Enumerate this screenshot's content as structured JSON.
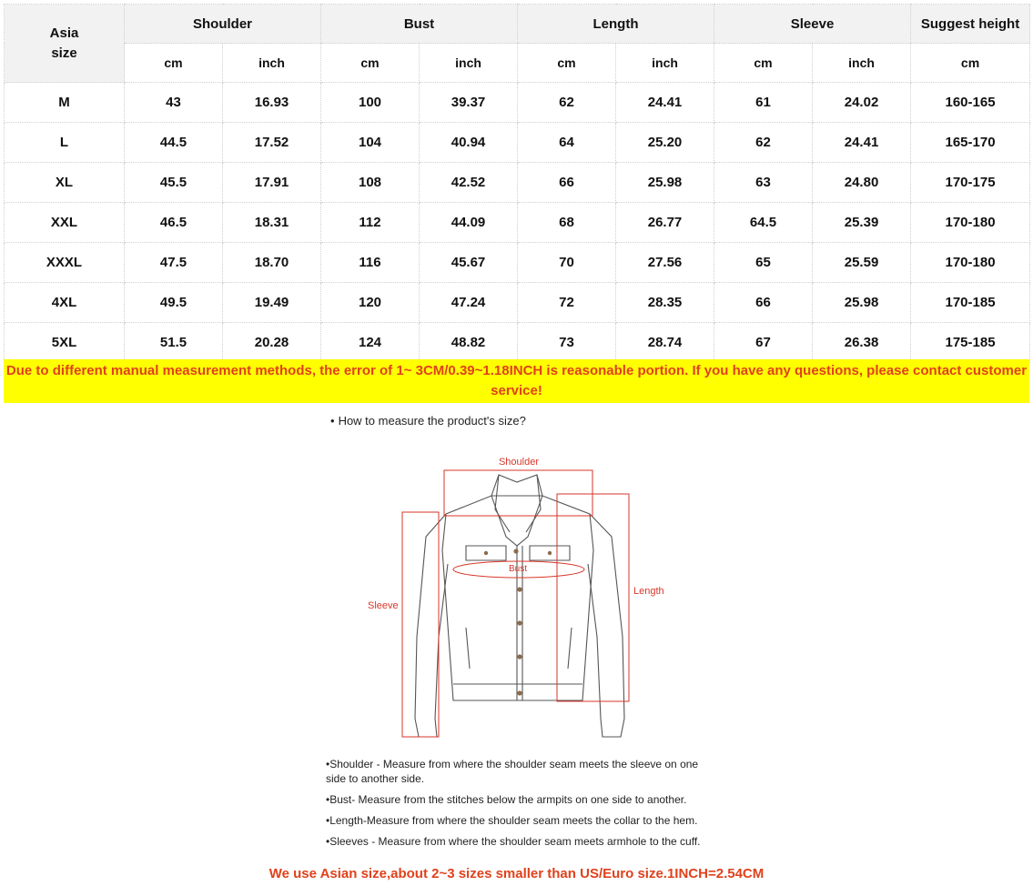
{
  "table": {
    "groups": [
      "Shoulder",
      "Bust",
      "Length",
      "Sleeve",
      "Suggest height"
    ],
    "asia_header_line1": "Asia",
    "asia_header_line2": "size",
    "units": [
      "cm",
      "inch",
      "cm",
      "inch",
      "cm",
      "inch",
      "cm",
      "inch",
      "cm"
    ],
    "rows": [
      [
        "M",
        "43",
        "16.93",
        "100",
        "39.37",
        "62",
        "24.41",
        "61",
        "24.02",
        "160-165"
      ],
      [
        "L",
        "44.5",
        "17.52",
        "104",
        "40.94",
        "64",
        "25.20",
        "62",
        "24.41",
        "165-170"
      ],
      [
        "XL",
        "45.5",
        "17.91",
        "108",
        "42.52",
        "66",
        "25.98",
        "63",
        "24.80",
        "170-175"
      ],
      [
        "XXL",
        "46.5",
        "18.31",
        "112",
        "44.09",
        "68",
        "26.77",
        "64.5",
        "25.39",
        "170-180"
      ],
      [
        "XXXL",
        "47.5",
        "18.70",
        "116",
        "45.67",
        "70",
        "27.56",
        "65",
        "25.59",
        "170-180"
      ],
      [
        "4XL",
        "49.5",
        "19.49",
        "120",
        "47.24",
        "72",
        "28.35",
        "66",
        "25.98",
        "170-185"
      ],
      [
        "5XL",
        "51.5",
        "20.28",
        "124",
        "48.82",
        "73",
        "28.74",
        "67",
        "26.38",
        "175-185"
      ]
    ]
  },
  "notice": "Due to different manual measurement methods, the error of 1~ 3CM/0.39~1.18INCH is reasonable portion. If you have any questions, please contact customer service!",
  "howto": "How to measure the product's size?",
  "diagram": {
    "labels": {
      "shoulder": "Shoulder",
      "bust": "Bust",
      "length": "Length",
      "sleeve": "Sleeve"
    },
    "accent_color": "#d9362a"
  },
  "notes": [
    "•Shoulder - Measure from where the shoulder seam meets the sleeve on one side to another side.",
    "•Bust- Measure from the stitches below the armpits on one side to another.",
    "•Length-Measure from where the shoulder seam meets the collar to the hem.",
    "•Sleeves - Measure from where the shoulder seam meets armhole to the cuff."
  ],
  "footer": "We use Asian size,about 2~3 sizes smaller than US/Euro size.1INCH=2.54CM"
}
